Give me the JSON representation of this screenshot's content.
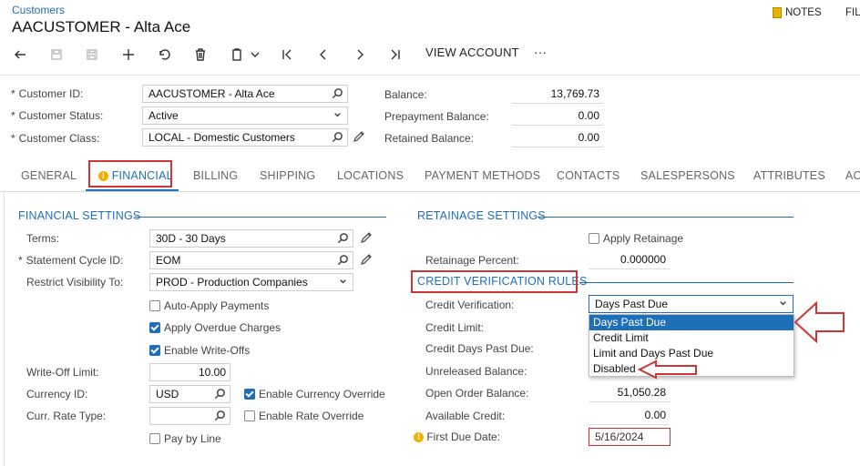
{
  "breadcrumb": "Customers",
  "page_title": "AACUSTOMER - Alta Ace",
  "top_actions": {
    "notes": "NOTES",
    "files": "FIL"
  },
  "toolbar": {
    "view_account": "VIEW ACCOUNT",
    "more": "···"
  },
  "header": {
    "customer_id_label": "Customer ID:",
    "customer_id_value": "AACUSTOMER - Alta Ace",
    "customer_status_label": "Customer Status:",
    "customer_status_value": "Active",
    "customer_class_label": "Customer Class:",
    "customer_class_value": "LOCAL - Domestic Customers",
    "balance_label": "Balance:",
    "balance_value": "13,769.73",
    "prepayment_label": "Prepayment Balance:",
    "prepayment_value": "0.00",
    "retained_label": "Retained Balance:",
    "retained_value": "0.00",
    "required_mark": "*"
  },
  "tabs": [
    "GENERAL",
    "FINANCIAL",
    "BILLING",
    "SHIPPING",
    "LOCATIONS",
    "PAYMENT METHODS",
    "CONTACTS",
    "SALESPERSONS",
    "ATTRIBUTES",
    "AC"
  ],
  "financial": {
    "title": "FINANCIAL SETTINGS",
    "terms_label": "Terms:",
    "terms_value": "30D - 30 Days",
    "cycle_label": "Statement Cycle ID:",
    "cycle_value": "EOM",
    "visibility_label": "Restrict Visibility To:",
    "visibility_value": "PROD - Production Companies",
    "auto_apply": "Auto-Apply Payments",
    "overdue": "Apply Overdue Charges",
    "writeoffs": "Enable Write-Offs",
    "writeoff_limit_label": "Write-Off Limit:",
    "writeoff_limit_value": "10.00",
    "currency_label": "Currency ID:",
    "currency_value": "USD",
    "currency_override": "Enable Currency Override",
    "rate_type_label": "Curr. Rate Type:",
    "rate_override": "Enable Rate Override",
    "pay_by_line": "Pay by Line"
  },
  "retainage": {
    "title": "RETAINAGE SETTINGS",
    "apply": "Apply Retainage",
    "percent_label": "Retainage Percent:",
    "percent_value": "0.000000"
  },
  "credit": {
    "title": "CREDIT VERIFICATION RULES",
    "verification_label": "Credit Verification:",
    "verification_value": "Days Past Due",
    "limit_label": "Credit Limit:",
    "days_label": "Credit Days Past Due:",
    "unreleased_label": "Unreleased Balance:",
    "open_order_label": "Open Order Balance:",
    "open_order_value": "51,050.28",
    "available_label": "Available Credit:",
    "available_value": "0.00",
    "first_due_label": "First Due Date:",
    "first_due_value": "5/16/2024",
    "options": [
      "Days Past Due",
      "Credit Limit",
      "Limit and Days Past Due",
      "Disabled"
    ]
  },
  "colors": {
    "accent": "#1f6fb8",
    "highlight": "#d03434",
    "warning": "#e8b400"
  }
}
